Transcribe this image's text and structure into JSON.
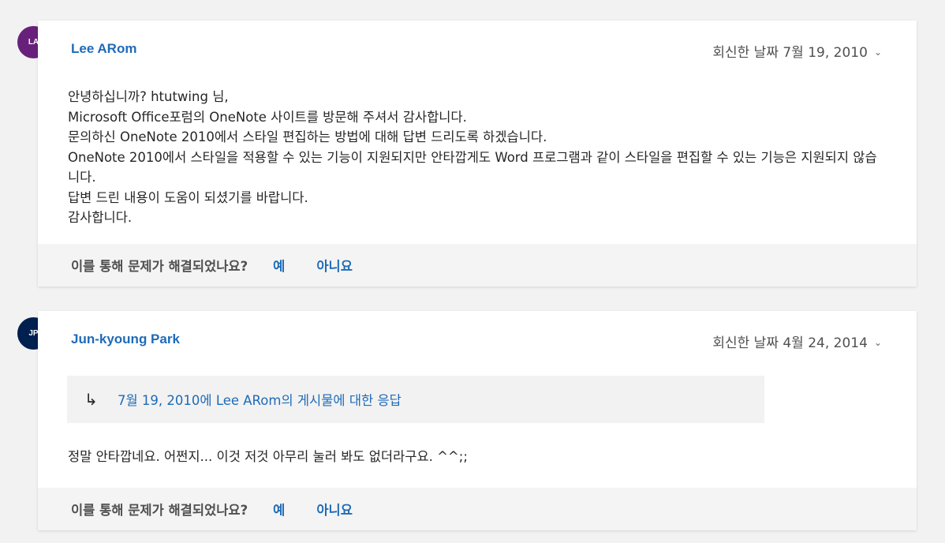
{
  "colors": {
    "accent": "#1e6bb8",
    "avatar1": "#68217a",
    "avatar2": "#002050"
  },
  "replies": [
    {
      "initials": "LA",
      "author": "Lee ARom",
      "date": "회신한 날짜 7월 19, 2010",
      "lines": [
        "안녕하십니까? htutwing 님,",
        "Microsoft Office포럼의 OneNote 사이트를 방문해 주셔서 감사합니다.",
        "문의하신 OneNote 2010에서 스타일 편집하는 방법에 대해 답변 드리도록 하겠습니다.",
        "OneNote 2010에서 스타일을 적용할 수 있는 기능이 지원되지만 안타깝게도 Word 프로그램과 같이 스타일을 편집할 수 있는 기능은 지원되지 않습니다.",
        "답변 드린 내용이 도움이 되셨기를 바랍니다.",
        "감사합니다."
      ],
      "feedback": {
        "question": "이를 통해 문제가 해결되었나요?",
        "yes": "예",
        "no": "아니요"
      }
    },
    {
      "initials": "JP",
      "author": "Jun-kyoung Park",
      "date": "회신한 날짜 4월 24, 2014",
      "quote_link": "7월 19, 2010에 Lee ARom의 게시물에 대한 응답",
      "text": "정말 안타깝네요. 어쩐지... 이것 저것 아무리 눌러 봐도 없더라구요. ^^;;",
      "feedback": {
        "question": "이를 통해 문제가 해결되었나요?",
        "yes": "예",
        "no": "아니요"
      }
    }
  ]
}
